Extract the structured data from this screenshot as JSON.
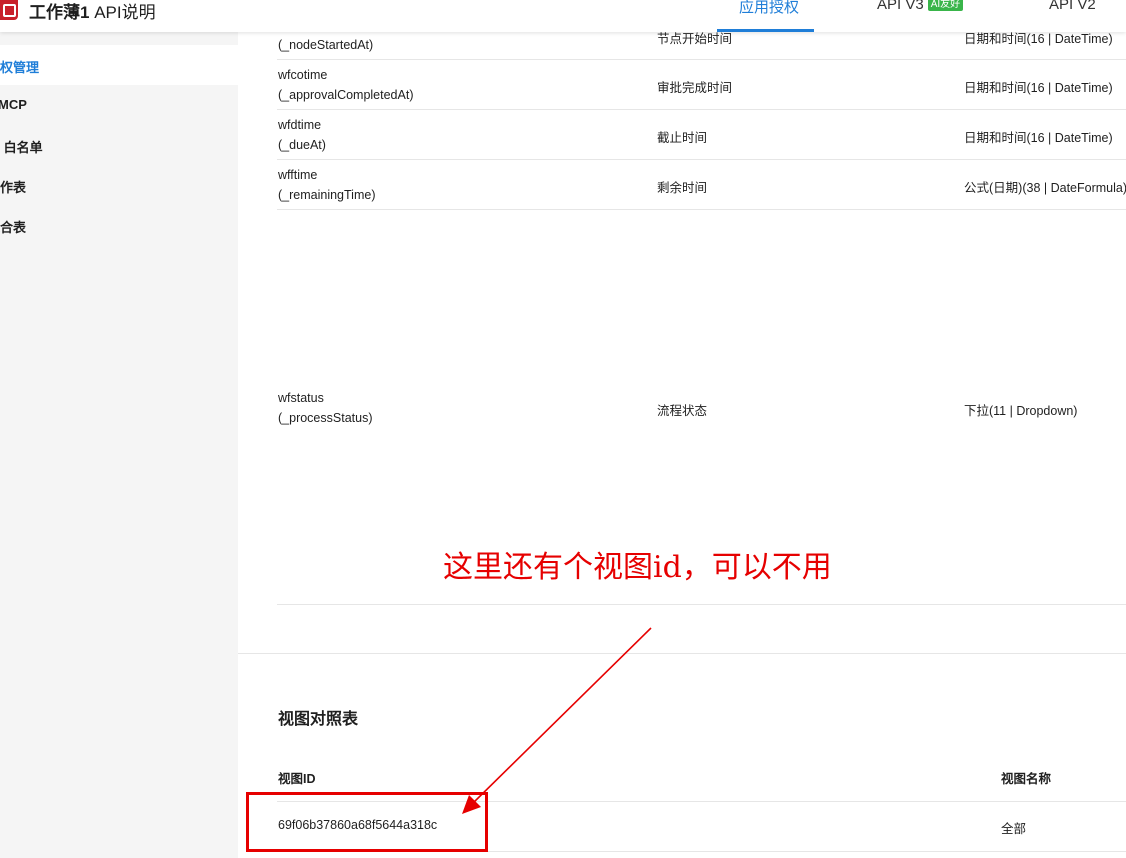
{
  "header": {
    "title_bold": "工作薄1",
    "title_rest": " API说明",
    "nav": [
      {
        "label": "应用授权",
        "active": true
      },
      {
        "label": "API V3",
        "badge": "AI友好"
      },
      {
        "label": "API V2"
      }
    ]
  },
  "sidebar": {
    "items": [
      {
        "label": "授权管理",
        "active": true
      },
      {
        "label": "MCP"
      },
      {
        "label": "IP 白名单"
      },
      {
        "label": "工作表"
      },
      {
        "label": "聚合表"
      }
    ]
  },
  "fields": [
    {
      "alias": "",
      "id": "(_nodeStartedAt)",
      "name": "节点开始时间",
      "type": "日期和时间(16 | DateTime)"
    },
    {
      "alias": "wfcotime",
      "id": "(_approvalCompletedAt)",
      "name": "审批完成时间",
      "type": "日期和时间(16 | DateTime)"
    },
    {
      "alias": "wfdtime",
      "id": "(_dueAt)",
      "name": "截止时间",
      "type": "日期和时间(16 | DateTime)"
    },
    {
      "alias": "wfftime",
      "id": "(_remainingTime)",
      "name": "剩余时间",
      "type": "公式(日期)(38 | DateFormula)"
    },
    {
      "alias": "wfstatus",
      "id": "(_processStatus)",
      "name": "流程状态",
      "type": "下拉(11 | Dropdown)"
    }
  ],
  "views": {
    "title": "视图对照表",
    "col_id": "视图ID",
    "col_name": "视图名称",
    "rows": [
      {
        "id": "69f06b37860a68f5644a318c",
        "name": "全部"
      }
    ]
  },
  "annotation": {
    "text": "这里还有个视图id，可以不用",
    "color": "#e60000"
  }
}
